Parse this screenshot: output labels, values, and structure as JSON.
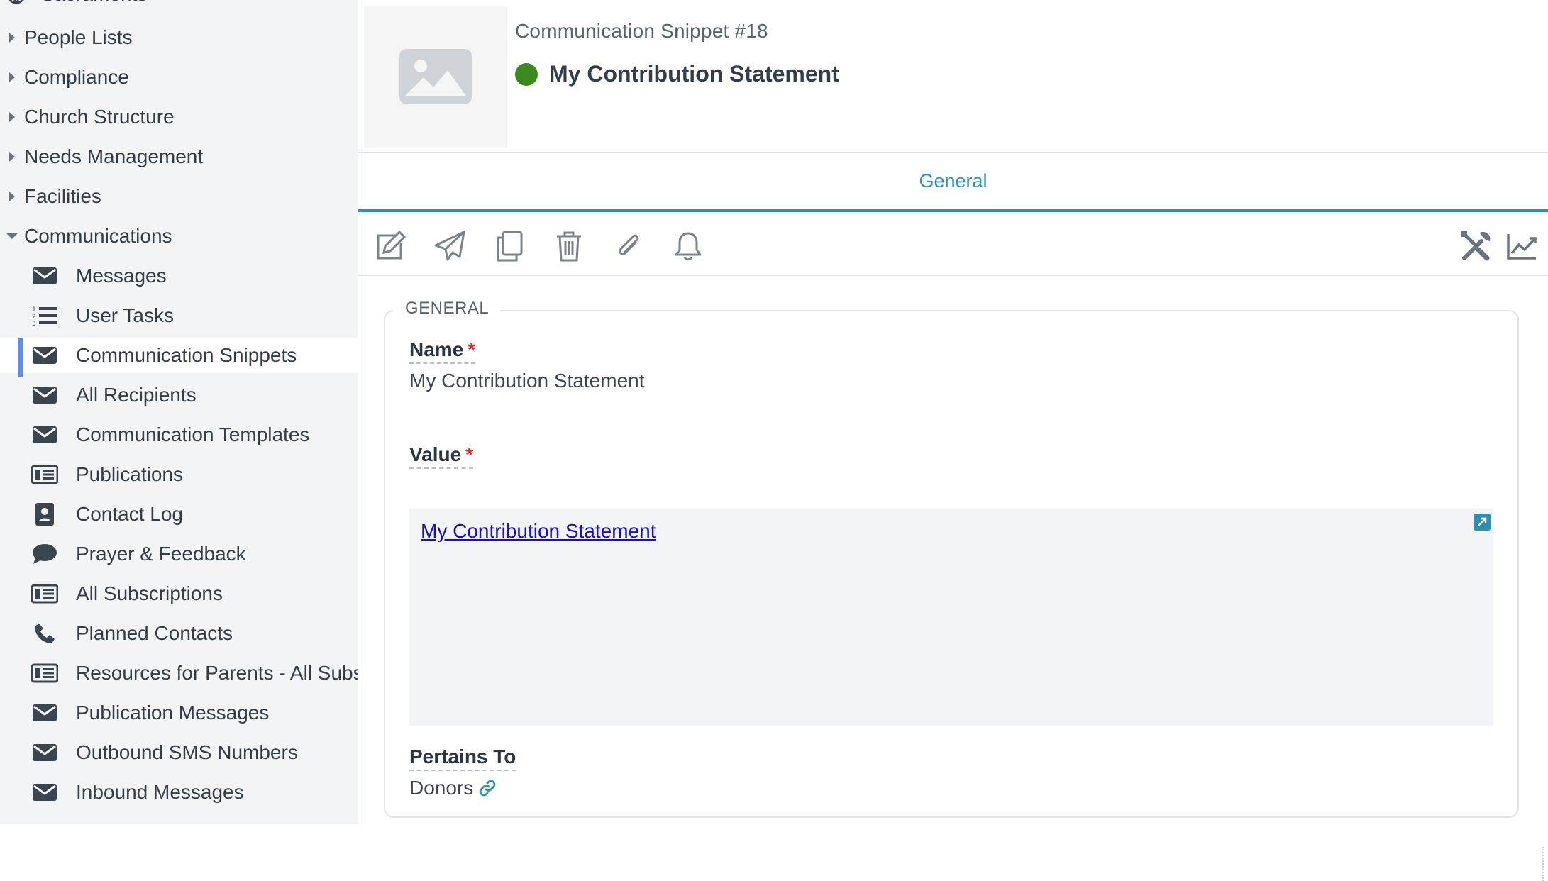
{
  "sidebar": {
    "partial_top": "Sacraments",
    "groups": [
      {
        "label": "People Lists"
      },
      {
        "label": "Compliance"
      },
      {
        "label": "Church Structure"
      },
      {
        "label": "Needs Management"
      },
      {
        "label": "Facilities"
      },
      {
        "label": "Communications"
      }
    ],
    "items": [
      {
        "label": "Messages",
        "icon": "envelope-icon"
      },
      {
        "label": "User Tasks",
        "icon": "list-ordered-icon"
      },
      {
        "label": "Communication Snippets",
        "icon": "envelope-icon",
        "active": true
      },
      {
        "label": "All Recipients",
        "icon": "envelope-icon"
      },
      {
        "label": "Communication Templates",
        "icon": "envelope-icon"
      },
      {
        "label": "Publications",
        "icon": "newspaper-icon"
      },
      {
        "label": "Contact Log",
        "icon": "contact-card-icon"
      },
      {
        "label": "Prayer & Feedback",
        "icon": "speech-bubble-icon"
      },
      {
        "label": "All Subscriptions",
        "icon": "newspaper-icon"
      },
      {
        "label": "Planned Contacts",
        "icon": "phone-icon"
      },
      {
        "label": "Resources for Parents - All Subscriptions",
        "icon": "newspaper-icon"
      },
      {
        "label": "Publication Messages",
        "icon": "envelope-icon"
      },
      {
        "label": "Outbound SMS Numbers",
        "icon": "envelope-icon"
      },
      {
        "label": "Inbound Messages",
        "icon": "envelope-icon"
      }
    ]
  },
  "header": {
    "record_type": "Communication Snippet #18",
    "title": "My Contribution Statement",
    "status_color": "#3b8a1e"
  },
  "tabs": [
    {
      "label": "General",
      "active": true
    }
  ],
  "toolbar": {
    "left": [
      "edit-icon",
      "send-icon",
      "copy-icon",
      "trash-icon",
      "paperclip-icon",
      "bell-icon"
    ],
    "right": [
      "tools-icon",
      "chart-line-icon"
    ]
  },
  "form": {
    "section_label": "GENERAL",
    "name_label": "Name",
    "name_value": "My Contribution Statement",
    "value_label": "Value",
    "value_link": "My Contribution Statement",
    "pertains_label": "Pertains To",
    "pertains_value": "Donors",
    "required_marker": "*"
  },
  "colors": {
    "accent": "#2f8fb3",
    "active_indicator": "#5b8ee6",
    "required": "#d23030",
    "link": "#1a0dcc"
  }
}
